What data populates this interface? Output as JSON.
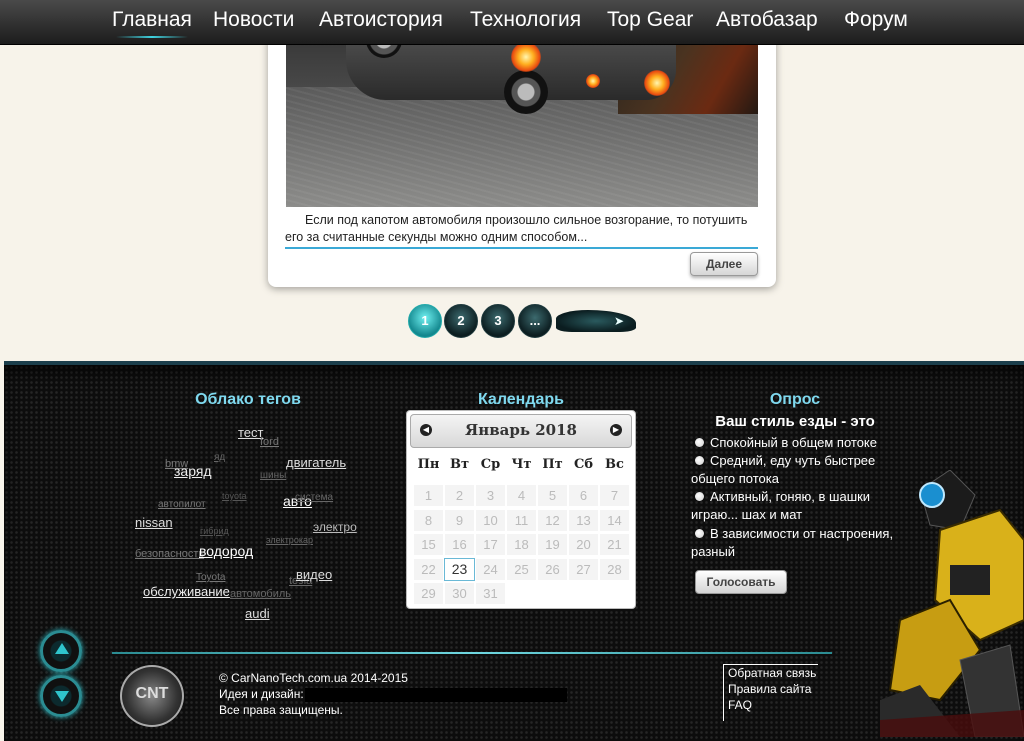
{
  "nav": {
    "items": [
      {
        "label": "Главная"
      },
      {
        "label": "Новости"
      },
      {
        "label": "Автоистория"
      },
      {
        "label": "Технология"
      },
      {
        "label": "Top Gear"
      },
      {
        "label": "Автобазар"
      },
      {
        "label": "Форум"
      }
    ]
  },
  "article": {
    "description": "Если под капотом автомобиля произошло сильное возгорание, то потушить его за считанные секунды можно одним способом...",
    "more_label": "Далее"
  },
  "pagination": {
    "pages": [
      "1",
      "2",
      "3",
      "..."
    ],
    "next_icon": "car-arrow-icon"
  },
  "tag_cloud": {
    "title": "Облако тегов",
    "tags": [
      "тест",
      "ford",
      "bmw",
      "яд",
      "заряд",
      "двигатель",
      "шины",
      "toyota",
      "авто",
      "автопилот",
      "система",
      "nissan",
      "электро",
      "гибрид",
      "электрокар",
      "безопасность",
      "водород",
      "Toyota",
      "tesla",
      "видео",
      "автомобиль",
      "обслуживание",
      "audi"
    ]
  },
  "calendar": {
    "title": "Календарь",
    "month": "Январь 2018",
    "prev_icon": "chevron-left-icon",
    "next_icon": "chevron-right-icon",
    "weekdays": [
      "Пн",
      "Вт",
      "Ср",
      "Чт",
      "Пт",
      "Сб",
      "Вс"
    ],
    "days": [
      "1",
      "2",
      "3",
      "4",
      "5",
      "6",
      "7",
      "8",
      "9",
      "10",
      "11",
      "12",
      "13",
      "14",
      "15",
      "16",
      "17",
      "18",
      "19",
      "20",
      "21",
      "22",
      "23",
      "24",
      "25",
      "26",
      "27",
      "28",
      "29",
      "30",
      "31"
    ],
    "today": "23"
  },
  "poll": {
    "title": "Опрос",
    "question": "Ваш стиль езды - это",
    "options": [
      "Спокойный в общем потоке",
      "Средний, еду чуть быстрее общего потока",
      "Активный, гоняю, в шашки играю... шах и мат",
      "В зависимости от настроения, разный"
    ],
    "vote_label": "Голосовать"
  },
  "footer": {
    "logo_text": "CNT",
    "copyright": "© CarNanoTech.com.ua 2014-2015",
    "idea": "Идея и дизайн:",
    "rights": "Все права защищены.",
    "links": [
      "Обратная связь",
      "Правила сайта",
      "FAQ"
    ],
    "scroll_up_icon": "arrow-up-icon",
    "scroll_down_icon": "arrow-down-icon"
  }
}
